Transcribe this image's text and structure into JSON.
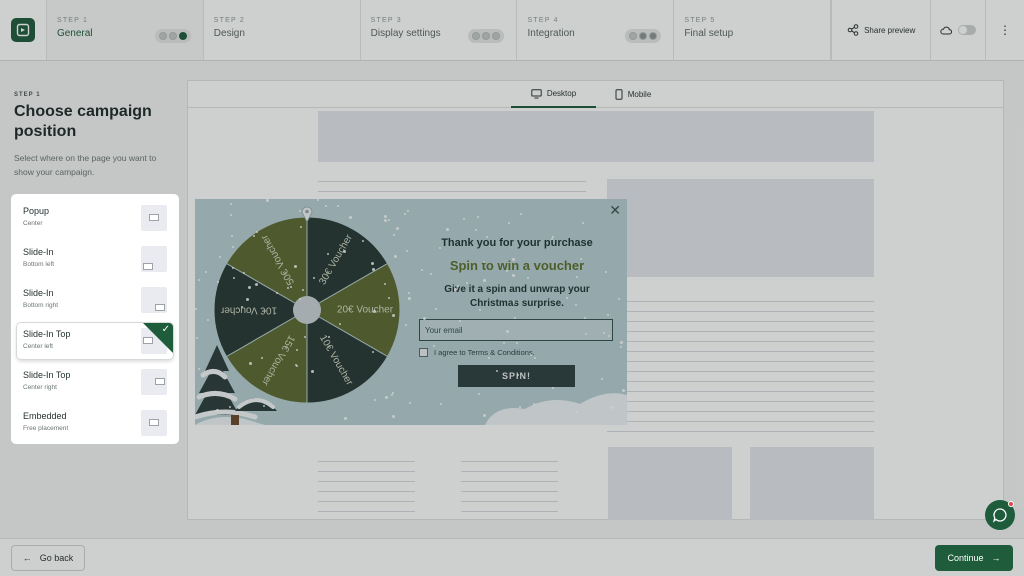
{
  "header": {
    "steps": [
      {
        "num": "STEP 1",
        "name": "General"
      },
      {
        "num": "STEP 2",
        "name": "Design"
      },
      {
        "num": "STEP 3",
        "name": "Display settings"
      },
      {
        "num": "STEP 4",
        "name": "Integration"
      },
      {
        "num": "STEP 5",
        "name": "Final setup"
      }
    ],
    "share_label": "Share preview"
  },
  "sidebar": {
    "step_label": "STEP 1",
    "title": "Choose campaign position",
    "description": "Select where on the page you want to show your campaign.",
    "options": [
      {
        "title": "Popup",
        "subtitle": "Center"
      },
      {
        "title": "Slide-In",
        "subtitle": "Bottom left"
      },
      {
        "title": "Slide-In",
        "subtitle": "Bottom right"
      },
      {
        "title": "Slide-In Top",
        "subtitle": "Center left"
      },
      {
        "title": "Slide-In Top",
        "subtitle": "Center right"
      },
      {
        "title": "Embedded",
        "subtitle": "Free placement"
      }
    ],
    "selected_index": 3
  },
  "preview": {
    "tabs": [
      {
        "label": "Desktop"
      },
      {
        "label": "Mobile"
      }
    ],
    "active_tab": "Desktop"
  },
  "popup": {
    "heading": "Thank you for your purchase",
    "subheading": "Spin to win a voucher",
    "description": "Give it a spin and unwrap your Christmas surprise.",
    "email_placeholder": "Your email",
    "agree_label": "I agree to Terms & Conditions.",
    "spin_label": "SPIN!",
    "wheel_segments": [
      "30€ Voucher",
      "20€ Voucher",
      "10€ Voucher",
      "15€ Voucher",
      "10€ Voucher",
      "50€ Voucher"
    ],
    "colors": {
      "dark": "#263634",
      "olive": "#5b6930",
      "background": "#b7cfd3"
    }
  },
  "footer": {
    "back_label": "Go back",
    "continue_label": "Continue"
  },
  "colors": {
    "brand": "#1e5c3c"
  }
}
